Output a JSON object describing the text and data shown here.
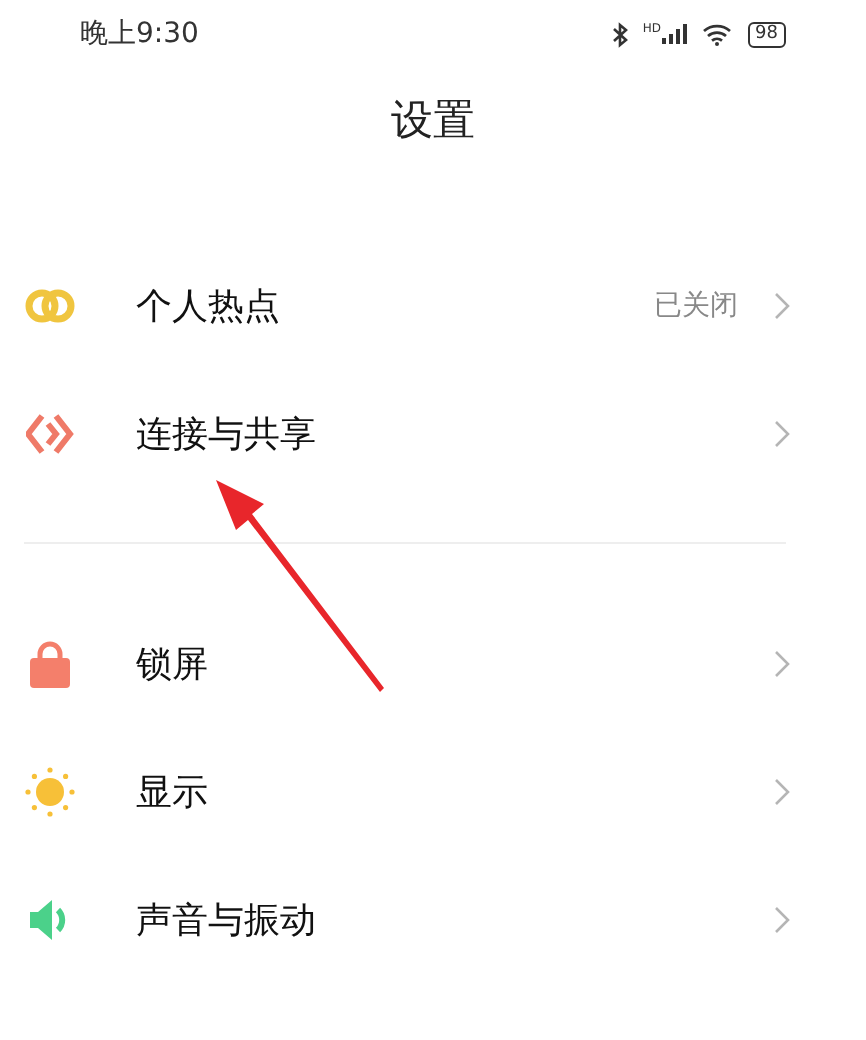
{
  "status_bar": {
    "time": "晚上9:30",
    "signal_label": "HD",
    "battery": "98"
  },
  "title": "设置",
  "sections": [
    {
      "items": [
        {
          "label": "个人热点",
          "value": "已关闭"
        },
        {
          "label": "连接与共享"
        }
      ]
    },
    {
      "items": [
        {
          "label": "锁屏"
        },
        {
          "label": "显示"
        },
        {
          "label": "声音与振动"
        }
      ]
    }
  ]
}
